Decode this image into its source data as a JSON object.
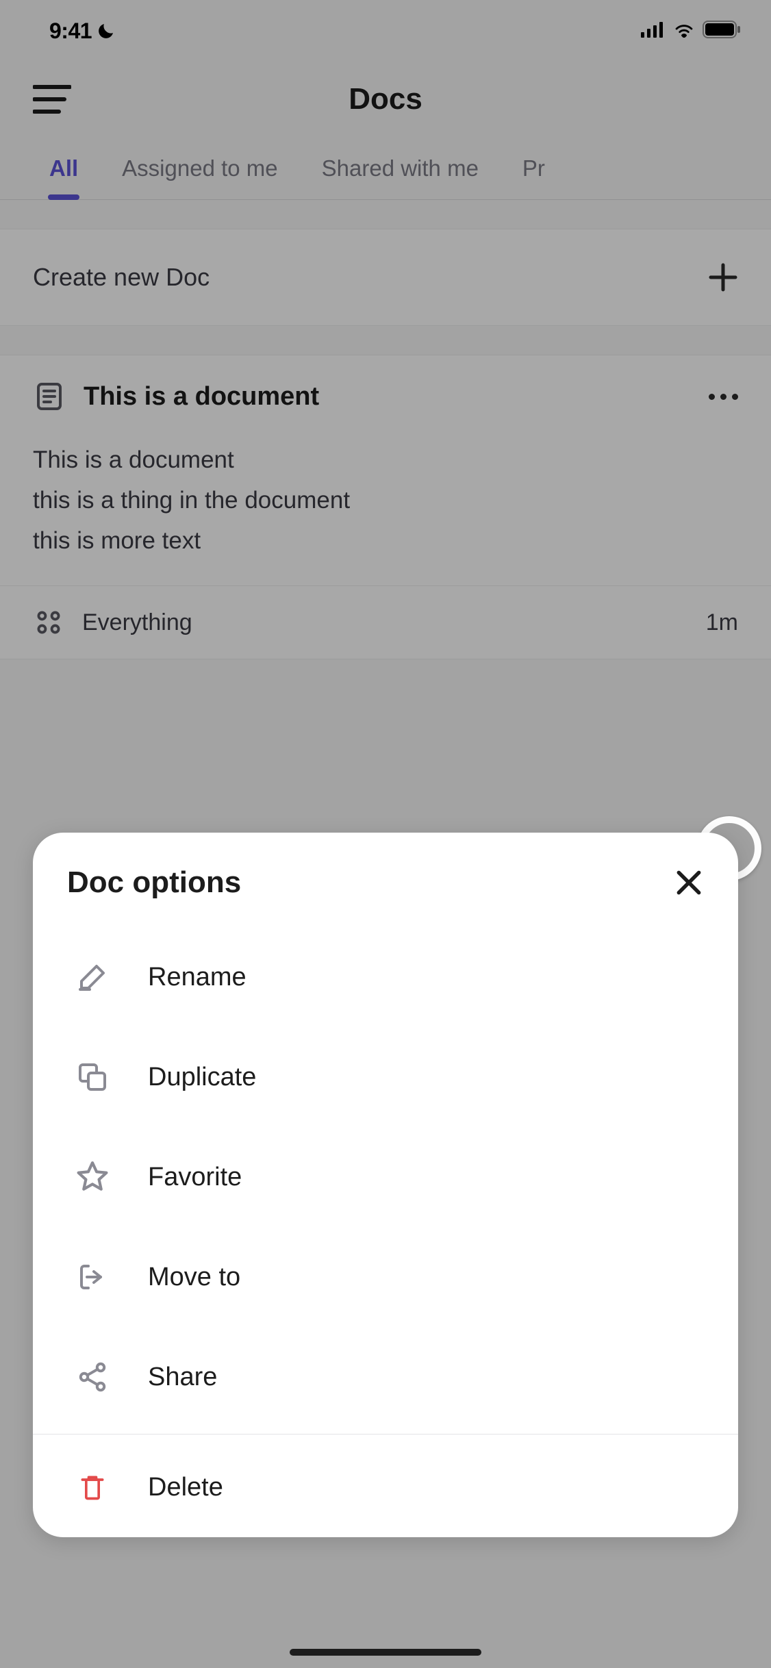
{
  "status": {
    "time": "9:41"
  },
  "header": {
    "title": "Docs"
  },
  "tabs": [
    {
      "label": "All",
      "active": true
    },
    {
      "label": "Assigned to me",
      "active": false
    },
    {
      "label": "Shared with me",
      "active": false
    },
    {
      "label": "Pr",
      "active": false
    }
  ],
  "create": {
    "label": "Create new Doc"
  },
  "doc": {
    "title": "This is a document",
    "body_line1": "This is a document",
    "body_line2": "this is a thing in the document",
    "body_line3": "this is more text",
    "footer_label": "Everything",
    "footer_time": "1m"
  },
  "sheet": {
    "title": "Doc options",
    "items": [
      {
        "label": "Rename",
        "icon": "pencil-icon"
      },
      {
        "label": "Duplicate",
        "icon": "duplicate-icon"
      },
      {
        "label": "Favorite",
        "icon": "star-icon"
      },
      {
        "label": "Move to",
        "icon": "move-icon"
      },
      {
        "label": "Share",
        "icon": "share-icon"
      }
    ],
    "delete": {
      "label": "Delete",
      "icon": "trash-icon"
    }
  }
}
